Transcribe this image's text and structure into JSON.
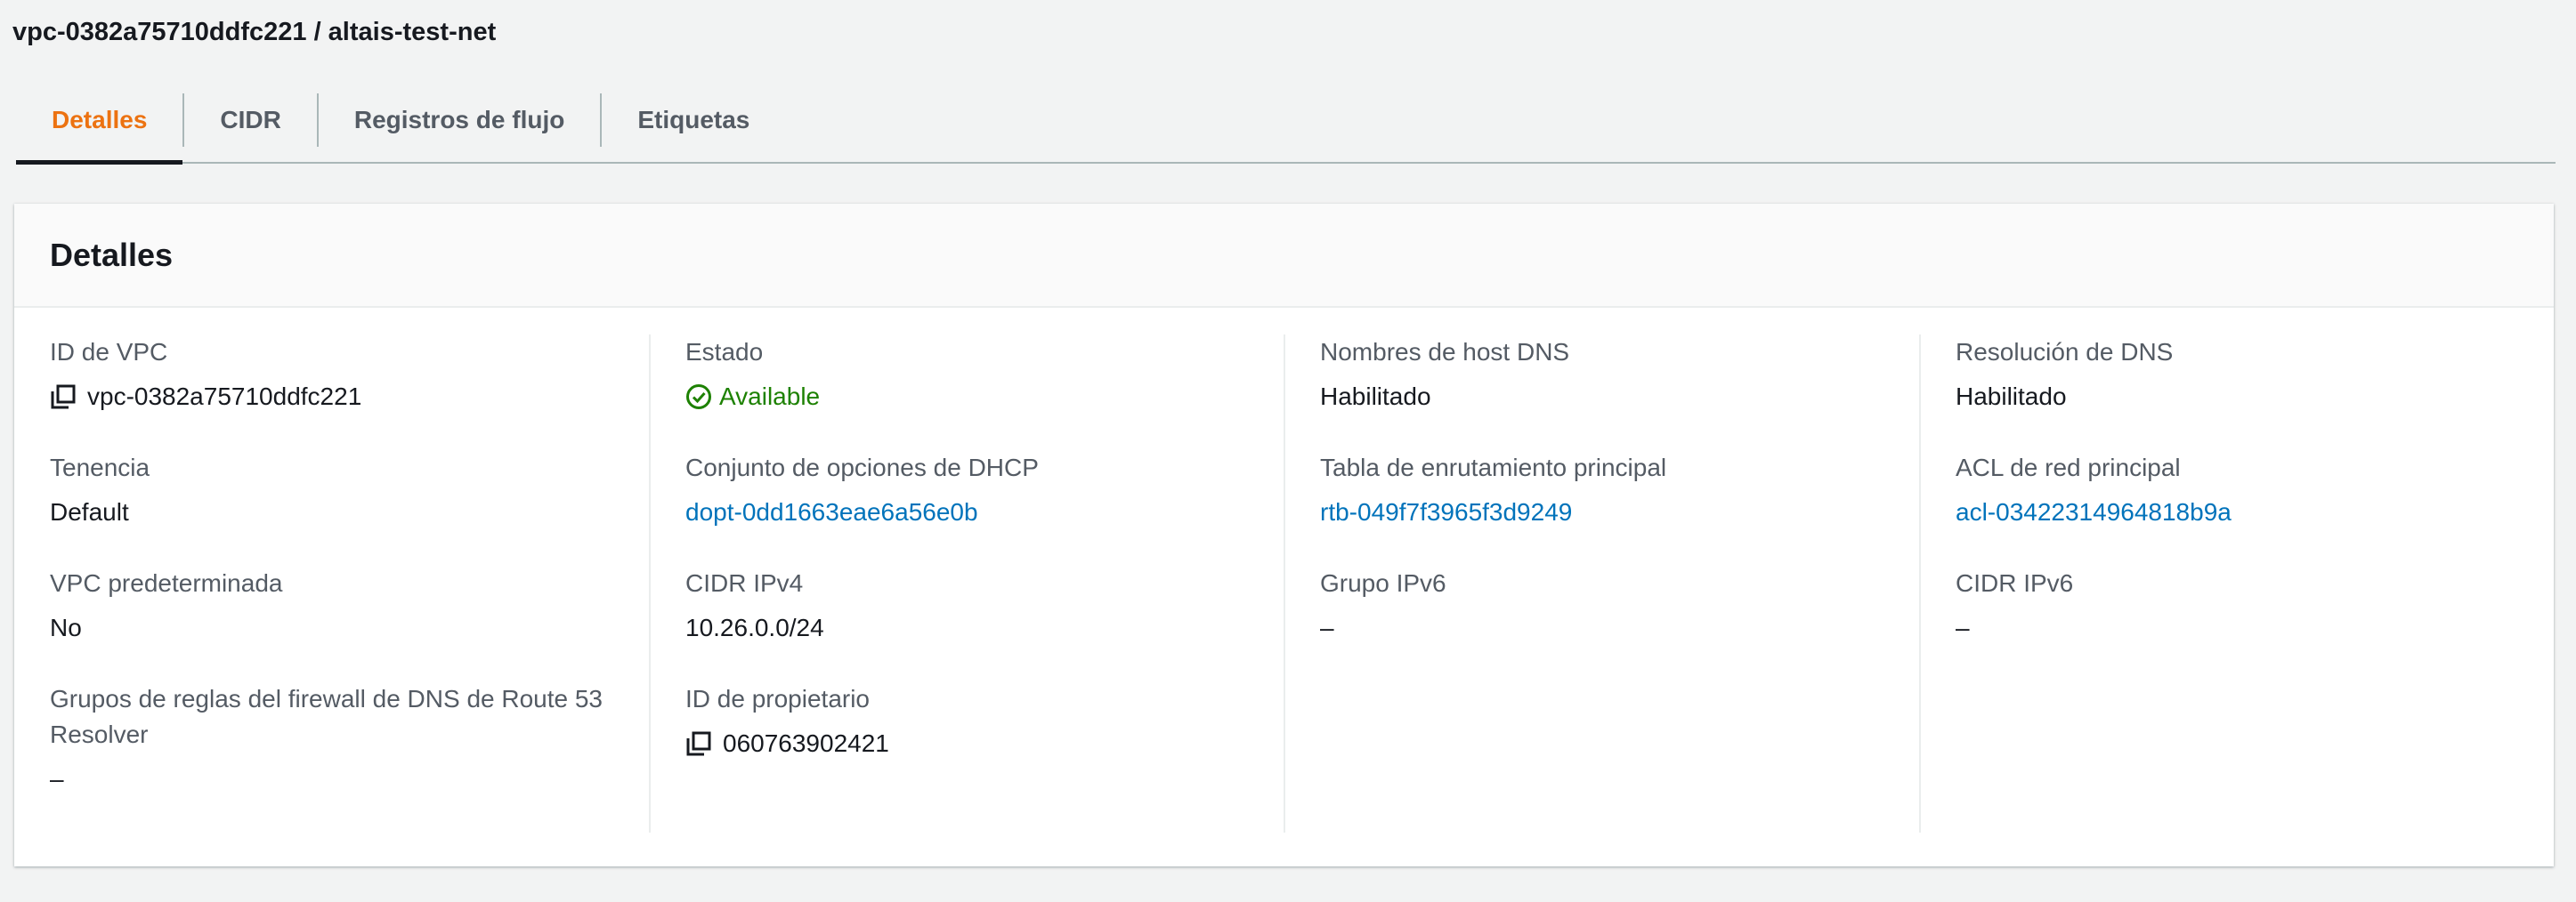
{
  "header": {
    "title": "vpc-0382a75710ddfc221 / altais-test-net"
  },
  "tabs": [
    {
      "label": "Detalles",
      "active": true
    },
    {
      "label": "CIDR",
      "active": false
    },
    {
      "label": "Registros de flujo",
      "active": false
    },
    {
      "label": "Etiquetas",
      "active": false
    }
  ],
  "colors": {
    "accent": "#ec7211",
    "link": "#0073bb",
    "status_ok": "#1d8102"
  },
  "details": {
    "title": "Detalles",
    "col1": {
      "vpc_id": {
        "label": "ID de VPC",
        "value": "vpc-0382a75710ddfc221",
        "icon": "copy-icon"
      },
      "tenancy": {
        "label": "Tenencia",
        "value": "Default"
      },
      "default_vpc": {
        "label": "VPC predeterminada",
        "value": "No"
      },
      "dns_firewall": {
        "label": "Grupos de reglas del firewall de DNS de Route 53 Resolver",
        "value": "–"
      }
    },
    "col2": {
      "state": {
        "label": "Estado",
        "value": "Available",
        "icon": "check-circle-icon"
      },
      "dhcp": {
        "label": "Conjunto de opciones de DHCP",
        "value": "dopt-0dd1663eae6a56e0b"
      },
      "ipv4": {
        "label": "CIDR IPv4",
        "value": "10.26.0.0/24"
      },
      "owner": {
        "label": "ID de propietario",
        "value": "060763902421",
        "icon": "copy-icon"
      }
    },
    "col3": {
      "dns_hostnames": {
        "label": "Nombres de host DNS",
        "value": "Habilitado"
      },
      "route_table": {
        "label": "Tabla de enrutamiento principal",
        "value": "rtb-049f7f3965f3d9249"
      },
      "ipv6_group": {
        "label": "Grupo IPv6",
        "value": "–"
      }
    },
    "col4": {
      "dns_resolution": {
        "label": "Resolución de DNS",
        "value": "Habilitado"
      },
      "network_acl": {
        "label": "ACL de red principal",
        "value": "acl-03422314964818b9a"
      },
      "ipv6_cidr": {
        "label": "CIDR IPv6",
        "value": "–"
      }
    }
  }
}
